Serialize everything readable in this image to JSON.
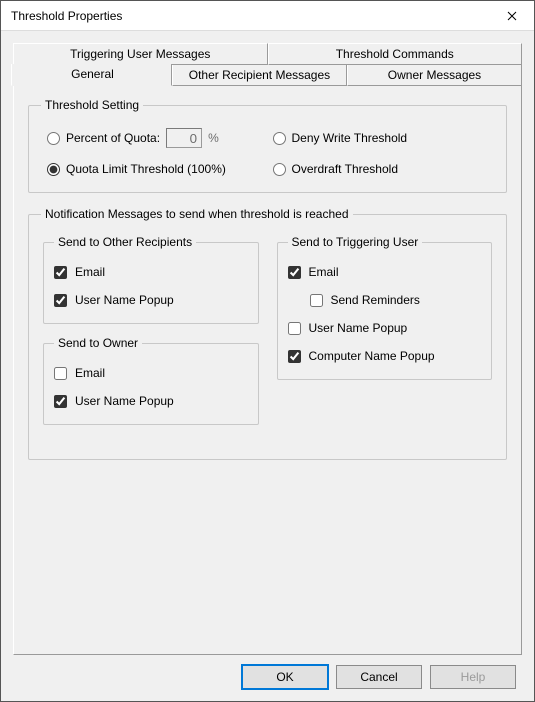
{
  "window": {
    "title": "Threshold Properties"
  },
  "tabs": {
    "top": [
      "Triggering User Messages",
      "Threshold Commands"
    ],
    "bottom": [
      "General",
      "Other Recipient Messages",
      "Owner Messages"
    ],
    "active": "General"
  },
  "threshold_setting": {
    "legend": "Threshold Setting",
    "percent_of_quota": {
      "label": "Percent of Quota:",
      "value": "0",
      "suffix": "%",
      "selected": false
    },
    "deny_write": {
      "label": "Deny Write Threshold",
      "selected": false
    },
    "quota_limit": {
      "label": "Quota Limit Threshold (100%)",
      "selected": true
    },
    "overdraft": {
      "label": "Overdraft Threshold",
      "selected": false
    }
  },
  "notifications": {
    "legend": "Notification Messages to send when threshold is reached",
    "other_recipients": {
      "legend": "Send to Other Recipients",
      "email": {
        "label": "Email",
        "checked": true
      },
      "username_popup": {
        "label": "User Name Popup",
        "checked": true
      }
    },
    "owner": {
      "legend": "Send to Owner",
      "email": {
        "label": "Email",
        "checked": false
      },
      "username_popup": {
        "label": "User Name Popup",
        "checked": true
      }
    },
    "triggering_user": {
      "legend": "Send to Triggering User",
      "email": {
        "label": "Email",
        "checked": true
      },
      "send_reminders": {
        "label": "Send Reminders",
        "checked": false
      },
      "username_popup": {
        "label": "User Name Popup",
        "checked": false
      },
      "computername_popup": {
        "label": "Computer Name Popup",
        "checked": true
      }
    }
  },
  "buttons": {
    "ok": "OK",
    "cancel": "Cancel",
    "help": "Help"
  }
}
